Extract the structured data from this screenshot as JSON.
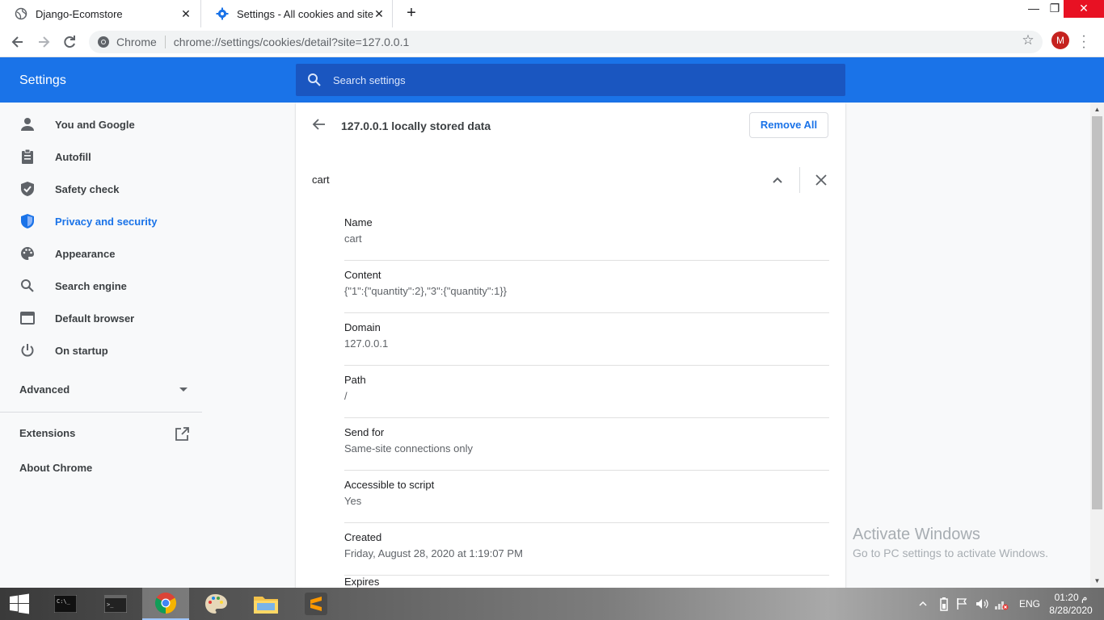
{
  "tabs": [
    {
      "title": "Django-Ecomstore",
      "active": false
    },
    {
      "title": "Settings - All cookies and site data",
      "active": true
    }
  ],
  "omnibox": {
    "chip": "Chrome",
    "url": "chrome://settings/cookies/detail?site=127.0.0.1"
  },
  "profile": {
    "initial": "M"
  },
  "header": {
    "title": "Settings",
    "search_placeholder": "Search settings"
  },
  "sidebar": {
    "items": [
      {
        "label": "You and Google",
        "icon": "person-icon"
      },
      {
        "label": "Autofill",
        "icon": "clipboard-icon"
      },
      {
        "label": "Safety check",
        "icon": "shield-check-icon"
      },
      {
        "label": "Privacy and security",
        "icon": "shield-icon",
        "selected": true
      },
      {
        "label": "Appearance",
        "icon": "palette-icon"
      },
      {
        "label": "Search engine",
        "icon": "search-icon"
      },
      {
        "label": "Default browser",
        "icon": "browser-icon"
      },
      {
        "label": "On startup",
        "icon": "power-icon"
      }
    ],
    "advanced": "Advanced",
    "extensions": "Extensions",
    "about": "About Chrome"
  },
  "main": {
    "heading": "127.0.0.1 locally stored data",
    "remove_all": "Remove All",
    "cookie_name": "cart",
    "fields": [
      {
        "label": "Name",
        "value": "cart"
      },
      {
        "label": "Content",
        "value": "{\"1\":{\"quantity\":2},\"3\":{\"quantity\":1}}"
      },
      {
        "label": "Domain",
        "value": "127.0.0.1"
      },
      {
        "label": "Path",
        "value": "/"
      },
      {
        "label": "Send for",
        "value": "Same-site connections only"
      },
      {
        "label": "Accessible to script",
        "value": "Yes"
      },
      {
        "label": "Created",
        "value": "Friday, August 28, 2020 at 1:19:07 PM"
      },
      {
        "label": "Expires",
        "value": ""
      }
    ]
  },
  "watermark": {
    "line1": "Activate Windows",
    "line2": "Go to PC settings to activate Windows."
  },
  "taskbar": {
    "tray": {
      "language": "ENG"
    },
    "clock": {
      "time": "01:20 م",
      "date": "8/28/2020"
    }
  },
  "colors": {
    "accent": "#1a73e8",
    "header_bg": "#1a73e8",
    "search_bg": "#1a56c0"
  }
}
